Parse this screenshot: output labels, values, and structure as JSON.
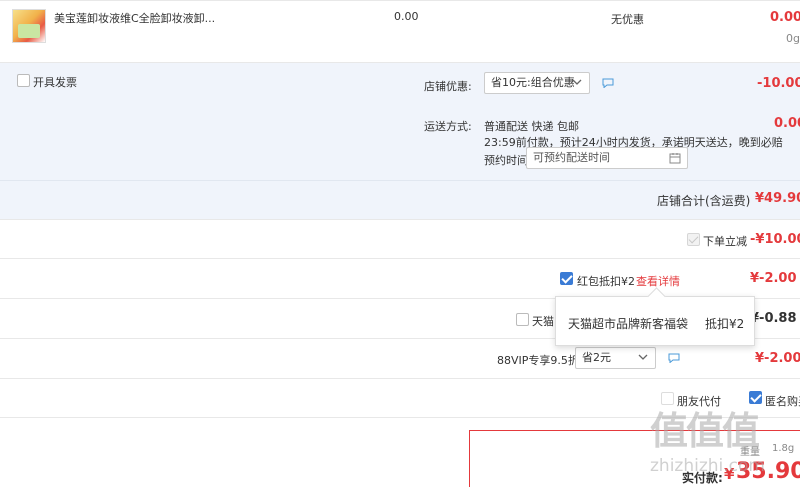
{
  "product": {
    "title": "美宝莲卸妆液维C全脸卸妆液卸...",
    "unit_price": "0.00",
    "discount": "无优惠",
    "subtotal": "0.00",
    "weight": "0g"
  },
  "store": {
    "invoice_label": "开具发票",
    "promo_label": "店铺优惠:",
    "promo_selected": "省10元:组合优惠",
    "promo_amount": "-10.00",
    "shipping_label": "运送方式:",
    "shipping_method": "普通配送 快递 包邮",
    "shipping_note": "23:59前付款，预计24小时内发货，承诺明天送达，晚到必赔",
    "shipping_fee": "0.00",
    "schedule_label": "预约时间",
    "schedule_placeholder": "可预约配送时间",
    "total_label": "店铺合计(含运费)",
    "total_amount": "¥49.90"
  },
  "discounts": {
    "instant_label": "下单立减",
    "instant_amount": "-¥10.00",
    "redpacket_label": "红包抵扣¥2",
    "redpacket_link": "查看详情",
    "redpacket_amount": "¥-2.00",
    "tmall_label": "天猫",
    "tmall_amount": "¥-0.88",
    "vip_label": "88VIP专享9.5折",
    "vip_selected": "省2元",
    "vip_amount": "¥-2.00",
    "friend_pay_label": "朋友代付",
    "anonymous_label": "匿名购买"
  },
  "tooltip": {
    "name": "天猫超市品牌新客福袋",
    "value": "抵扣¥2"
  },
  "order": {
    "weight_label": "重量",
    "weight_value": "1.8g",
    "pay_label": "实付款:",
    "pay_currency": "¥",
    "pay_amount": "35.90"
  },
  "watermark": {
    "logo": "值值值",
    "site": "zhizhizhi.com"
  },
  "colors": {
    "accent_red": "#e4393c",
    "checkbox_blue": "#3a7bd5",
    "panel_bg": "#f0f4fb"
  }
}
